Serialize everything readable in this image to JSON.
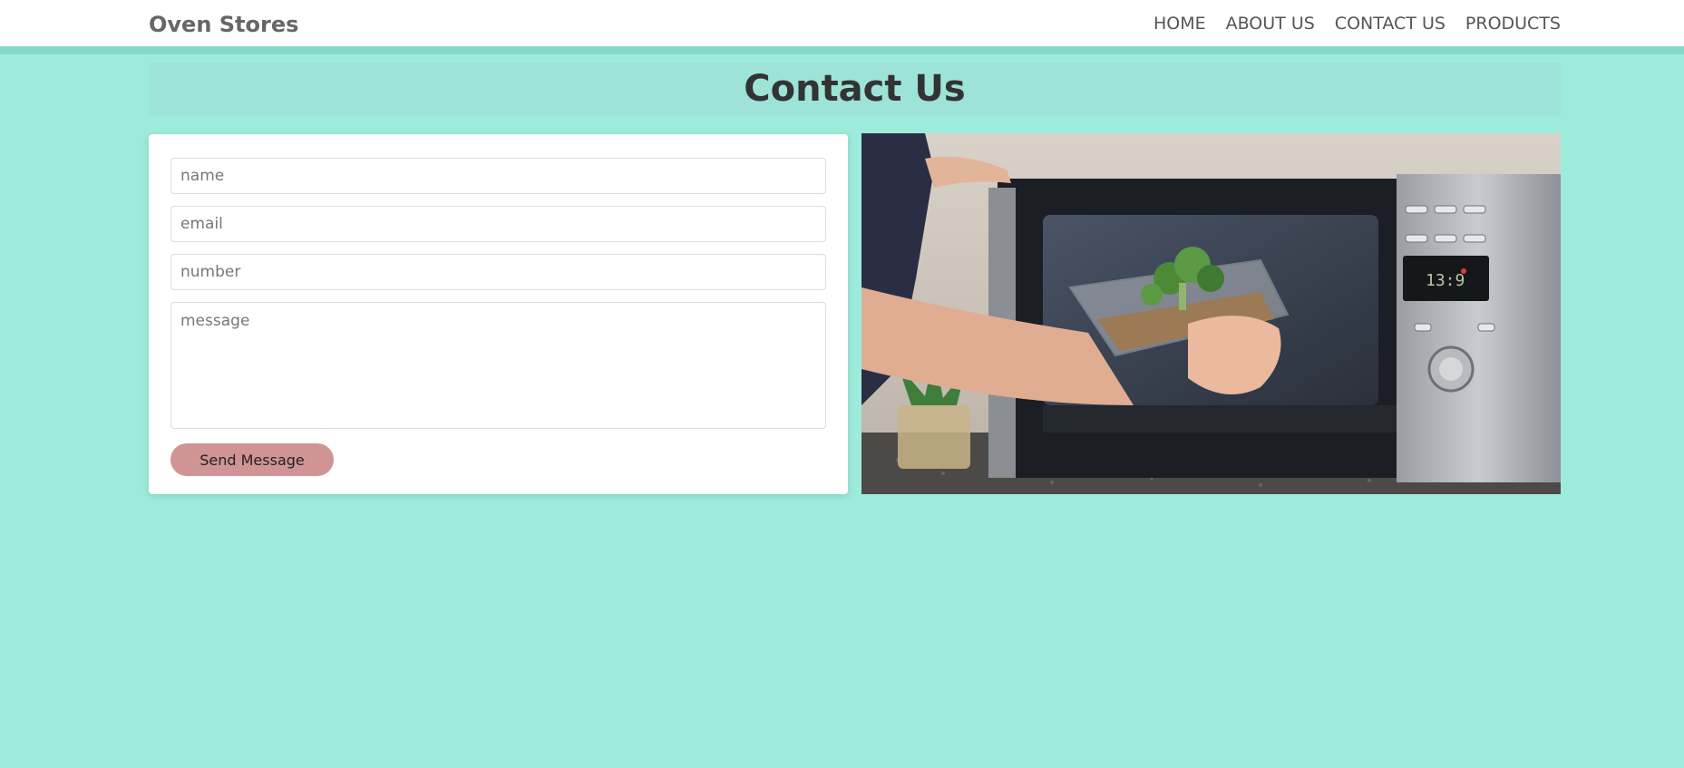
{
  "nav": {
    "brand": "Oven Stores",
    "links": [
      "HOME",
      "ABOUT US",
      "CONTACT US",
      "PRODUCTS"
    ]
  },
  "page": {
    "title": "Contact Us"
  },
  "form": {
    "name_placeholder": "name",
    "email_placeholder": "email",
    "number_placeholder": "number",
    "message_placeholder": "message",
    "submit_label": "Send Message"
  },
  "image": {
    "icon": "microwave-photo"
  },
  "colors": {
    "background": "#9debdb",
    "nav_border": "#86d9c8",
    "title_band": "#9de3d7",
    "button": "#d09494"
  }
}
